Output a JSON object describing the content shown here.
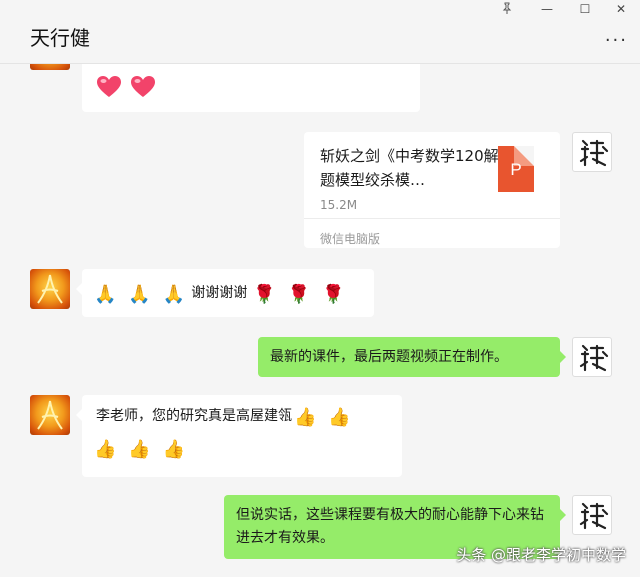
{
  "window": {
    "title": "天行健",
    "pin_icon": "pin-icon",
    "minimize_glyph": "—",
    "maximize_glyph": "☐",
    "close_glyph": "✕",
    "more_glyph": "···"
  },
  "messages": [
    {
      "sender": "contact",
      "type": "emoji",
      "emojis": [
        "red-heart",
        "red-heart"
      ]
    },
    {
      "sender": "me",
      "type": "file",
      "file_name": "斩妖之剑《中考数学120解题模型绞杀模…",
      "file_size": "15.2M",
      "file_source": "微信电脑版",
      "file_icon_letter": "P"
    },
    {
      "sender": "contact",
      "type": "text",
      "text": "谢谢谢谢",
      "emojis_before": [
        "folded-hands",
        "folded-hands",
        "folded-hands"
      ],
      "emojis_after": [
        "rose",
        "rose",
        "rose"
      ]
    },
    {
      "sender": "me",
      "type": "text",
      "text": "最新的课件，最后两题视频正在制作。"
    },
    {
      "sender": "contact",
      "type": "text",
      "text": "李老师，您的研究真是高屋建瓴",
      "emojis_after": [
        "thumbs-up",
        "thumbs-up",
        "thumbs-up",
        "thumbs-up",
        "thumbs-up"
      ]
    },
    {
      "sender": "me",
      "type": "text",
      "text": "但说实话，这些课程要有极大的耐心能静下心来钻进去才有效果。"
    }
  ],
  "watermark": "头条 @跟老李学初中数学",
  "colors": {
    "my_bubble": "#95ec69",
    "their_bubble": "#ffffff",
    "background": "#f5f5f5",
    "ppt": "#e8552f"
  }
}
